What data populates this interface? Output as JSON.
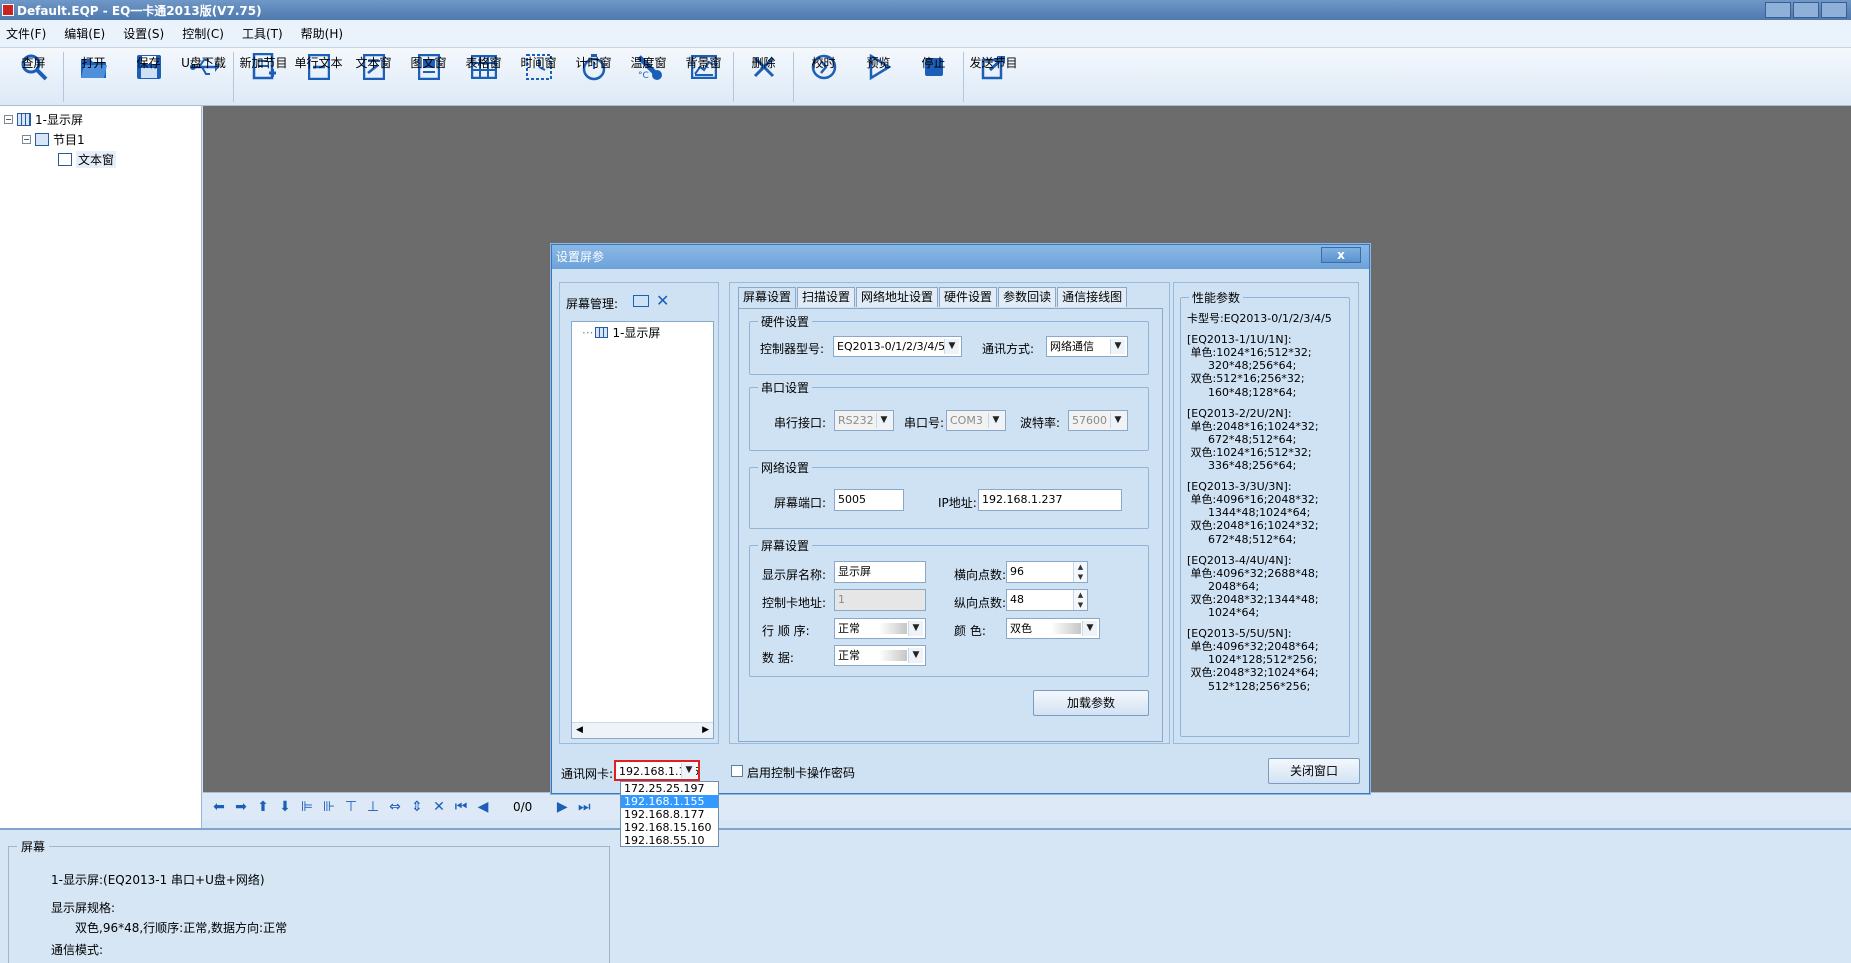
{
  "window": {
    "title": "Default.EQP - EQ一卡通2013版(V7.75)"
  },
  "menu": [
    "文件(F)",
    "编辑(E)",
    "设置(S)",
    "控制(C)",
    "工具(T)",
    "帮助(H)"
  ],
  "toolbar": {
    "search": "查屏",
    "open": "打开",
    "save": "保存",
    "usb": "U盘下载",
    "new_program": "新加节目",
    "single_text": "单行文本",
    "text_win": "文本窗",
    "image_text": "图文窗",
    "table_win": "表格窗",
    "time_win": "时间窗",
    "timer_win": "计时窗",
    "temp_win": "温度窗",
    "bg_win": "背景窗",
    "delete": "删除",
    "sync_time": "校时",
    "preview": "预览",
    "stop": "停止",
    "send": "发送节目"
  },
  "tree": {
    "screen": "1-显示屏",
    "program": "节目1",
    "text_window": "文本窗"
  },
  "nav": {
    "page_count": "0/0"
  },
  "info": {
    "legend": "屏幕",
    "line1": "1-显示屏:(EQ2013-1 串口+U盘+网络)",
    "line2": "显示屏规格:",
    "line3": "双色,96*48,行顺序:正常,数据方向:正常",
    "line4": "通信模式:"
  },
  "dialog": {
    "title": "设置屏参",
    "close_x": "x",
    "screen_mgmt": "屏幕管理:",
    "screen_item": "1-显示屏",
    "tabs": [
      "屏幕设置",
      "扫描设置",
      "网络地址设置",
      "硬件设置",
      "参数回读",
      "通信接线图"
    ],
    "hardware": {
      "legend": "硬件设置",
      "controller_label": "控制器型号:",
      "controller_value": "EQ2013-0/1/2/3/4/5",
      "comm_label": "通讯方式:",
      "comm_value": "网络通信"
    },
    "serial": {
      "legend": "串口设置",
      "iface_label": "串行接口:",
      "iface_value": "RS232",
      "port_label": "串口号:",
      "port_value": "COM3",
      "baud_label": "波特率:",
      "baud_value": "57600"
    },
    "network": {
      "legend": "网络设置",
      "port_label": "屏幕端口:",
      "port_value": "5005",
      "ip_label": "IP地址:",
      "ip_value": "192.168.1.237"
    },
    "screen": {
      "legend": "屏幕设置",
      "name_label": "显示屏名称:",
      "name_value": "显示屏",
      "width_label": "横向点数:",
      "width_value": "96",
      "addr_label": "控制卡地址:",
      "addr_value": "1",
      "height_label": "纵向点数:",
      "height_value": "48",
      "order_label": "行 顺 序:",
      "order_value": "正常",
      "color_label": "颜   色:",
      "color_value": "双色",
      "data_label": "数     据:",
      "data_value": "正常"
    },
    "load_btn": "加载参数",
    "perf": {
      "legend": "性能参数",
      "lines": [
        "卡型号:EQ2013-0/1/2/3/4/5",
        "",
        "[EQ2013-1/1U/1N]:",
        " 单色:1024*16;512*32;",
        "      320*48;256*64;",
        " 双色:512*16;256*32;",
        "      160*48;128*64;",
        "",
        "[EQ2013-2/2U/2N]:",
        " 单色:2048*16;1024*32;",
        "      672*48;512*64;",
        " 双色:1024*16;512*32;",
        "      336*48;256*64;",
        "",
        "[EQ2013-3/3U/3N]:",
        " 单色:4096*16;2048*32;",
        "      1344*48;1024*64;",
        " 双色:2048*16;1024*32;",
        "      672*48;512*64;",
        "",
        "[EQ2013-4/4U/4N]:",
        " 单色:4096*32;2688*48;",
        "      2048*64;",
        " 双色:2048*32;1344*48;",
        "      1024*64;",
        "",
        "[EQ2013-5/5U/5N]:",
        " 单色:4096*32;2048*64;",
        "      1024*128;512*256;",
        " 双色:2048*32;1024*64;",
        "      512*128;256*256;"
      ]
    },
    "nic_label": "通讯网卡:",
    "nic_value": "192.168.1.155",
    "nic_options": [
      "172.25.25.197",
      "192.168.1.155",
      "192.168.8.177",
      "192.168.15.160",
      "192.168.55.10"
    ],
    "password_label": "启用控制卡操作密码",
    "close_btn": "关闭窗口"
  },
  "colors": {
    "accent": "#1c5fb8",
    "highlight": "#3399ff",
    "alert_border": "#e02020"
  }
}
